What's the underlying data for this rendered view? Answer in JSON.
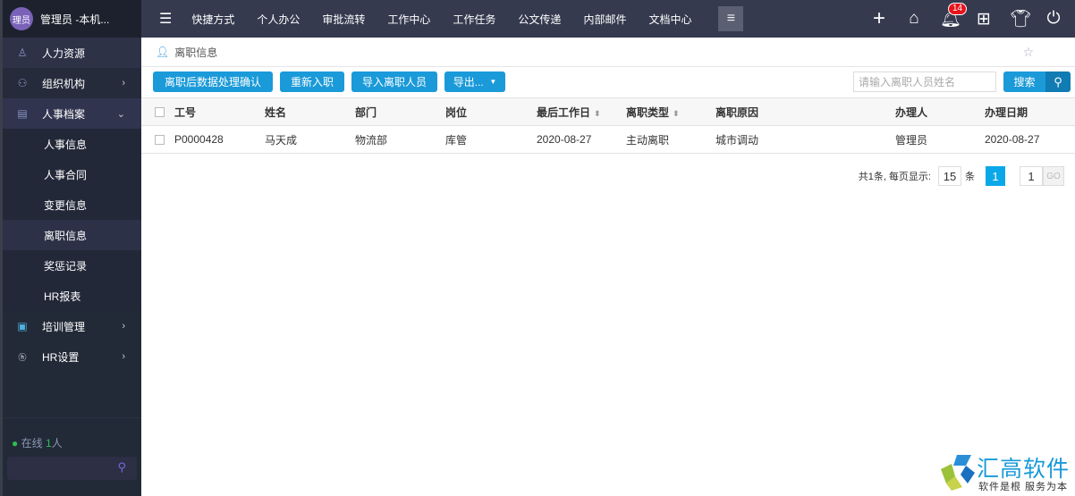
{
  "sidebar": {
    "avatar": "理员",
    "user": "管理员 -本机...",
    "items": [
      {
        "label": "人力资源",
        "icon": "user-list-icon"
      },
      {
        "label": "组织机构",
        "icon": "org-icon"
      },
      {
        "label": "人事档案",
        "icon": "file-icon"
      }
    ],
    "sub": [
      "人事信息",
      "人事合同",
      "变更信息",
      "离职信息",
      "奖惩记录",
      "HR报表"
    ],
    "items2": [
      {
        "label": "培训管理",
        "icon": "training-icon"
      },
      {
        "label": "HR设置",
        "icon": "hr-icon"
      }
    ],
    "online_label": "在线",
    "online_count": "1",
    "online_unit": "人"
  },
  "topnav": {
    "items": [
      "快捷方式",
      "个人办公",
      "审批流转",
      "工作中心",
      "工作任务",
      "公文传递",
      "内部邮件",
      "文档中心"
    ],
    "badge": "14"
  },
  "breadcrumb": "离职信息",
  "toolbar": {
    "btn1": "离职后数据处理确认",
    "btn2": "重新入职",
    "btn3": "导入离职人员",
    "btn4": "导出...",
    "search_placeholder": "请输入离职人员姓名",
    "search_label": "搜索"
  },
  "table": {
    "headers": [
      "工号",
      "姓名",
      "部门",
      "岗位",
      "最后工作日",
      "离职类型",
      "离职原因",
      "办理人",
      "办理日期"
    ],
    "rows": [
      [
        "P0000428",
        "马天成",
        "物流部",
        "库管",
        "2020-08-27",
        "主动离职",
        "城市调动",
        "管理员",
        "2020-08-27"
      ]
    ]
  },
  "pager": {
    "summary": "共1条, 每页显示:",
    "page_size": "15",
    "unit": "条",
    "current": "1",
    "goto": "1",
    "go": "GO"
  },
  "logo": {
    "name": "汇高软件",
    "slogan": "软件是根 服务为本"
  },
  "colors": {
    "accent": "#1a9ad9",
    "topbar": "#353a4f",
    "sidebar": "#222a38"
  }
}
